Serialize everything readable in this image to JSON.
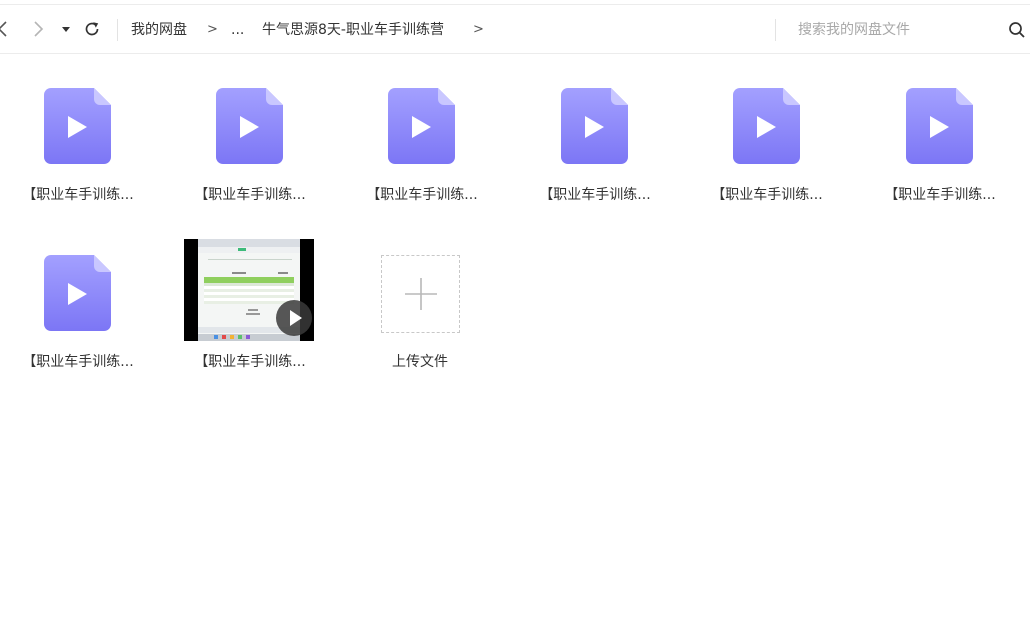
{
  "toolbar": {
    "back_icon": "chevron-left-icon",
    "forward_icon": "chevron-right-icon",
    "dropdown_icon": "caret-down-icon",
    "refresh_icon": "refresh-icon"
  },
  "breadcrumb": {
    "items": [
      "我的网盘",
      "...",
      "牛气思源8天-职业车手训练营"
    ],
    "separator": ">"
  },
  "search": {
    "placeholder": "搜索我的网盘文件",
    "value": "",
    "icon": "search-icon"
  },
  "files": [
    {
      "label": "【职业车手训练...",
      "icon": "video-file-icon"
    },
    {
      "label": "【职业车手训练...",
      "icon": "video-file-icon"
    },
    {
      "label": "【职业车手训练...",
      "icon": "video-file-icon"
    },
    {
      "label": "【职业车手训练...",
      "icon": "video-file-icon"
    },
    {
      "label": "【职业车手训练...",
      "icon": "video-file-icon"
    },
    {
      "label": "【职业车手训练...",
      "icon": "video-file-icon"
    },
    {
      "label": "【职业车手训练...",
      "icon": "video-file-icon"
    },
    {
      "label": "【职业车手训练...",
      "icon": "video-thumbnail"
    }
  ],
  "upload": {
    "label": "上传文件",
    "icon": "plus-icon"
  },
  "colors": {
    "file_icon_top": "#a3a0ff",
    "file_icon_bottom": "#7c76f5",
    "play": "#ffffff",
    "border": "#ececec"
  }
}
